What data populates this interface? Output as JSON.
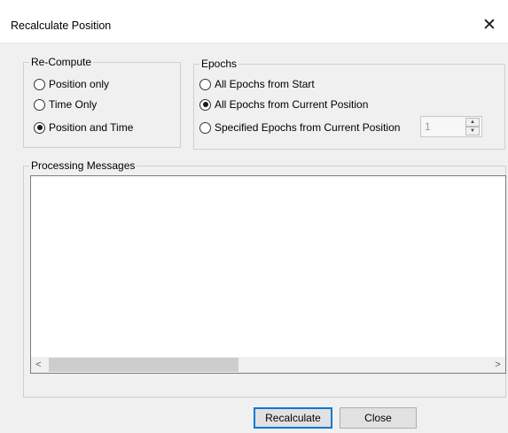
{
  "window": {
    "title": "Recalculate Position",
    "close_glyph": "✕"
  },
  "recompute": {
    "label": "Re-Compute",
    "options": [
      {
        "label": "Position only",
        "selected": false
      },
      {
        "label": "Time Only",
        "selected": false
      },
      {
        "label": "Position and Time",
        "selected": true
      }
    ]
  },
  "epochs": {
    "label": "Epochs",
    "options": [
      {
        "label": "All Epochs from Start",
        "selected": false
      },
      {
        "label": "All Epochs from Current Position",
        "selected": true
      },
      {
        "label": "Specified Epochs from Current Position",
        "selected": false
      }
    ],
    "spin_value": "1",
    "spin_up_glyph": "▲",
    "spin_down_glyph": "▼"
  },
  "processing": {
    "label": "Processing Messages",
    "scroll_left_glyph": "<",
    "scroll_right_glyph": ">"
  },
  "buttons": {
    "recalculate": "Recalculate",
    "close": "Close"
  },
  "colors": {
    "dialog_bg": "#f0f0f0",
    "default_button_border": "#0078d7"
  }
}
